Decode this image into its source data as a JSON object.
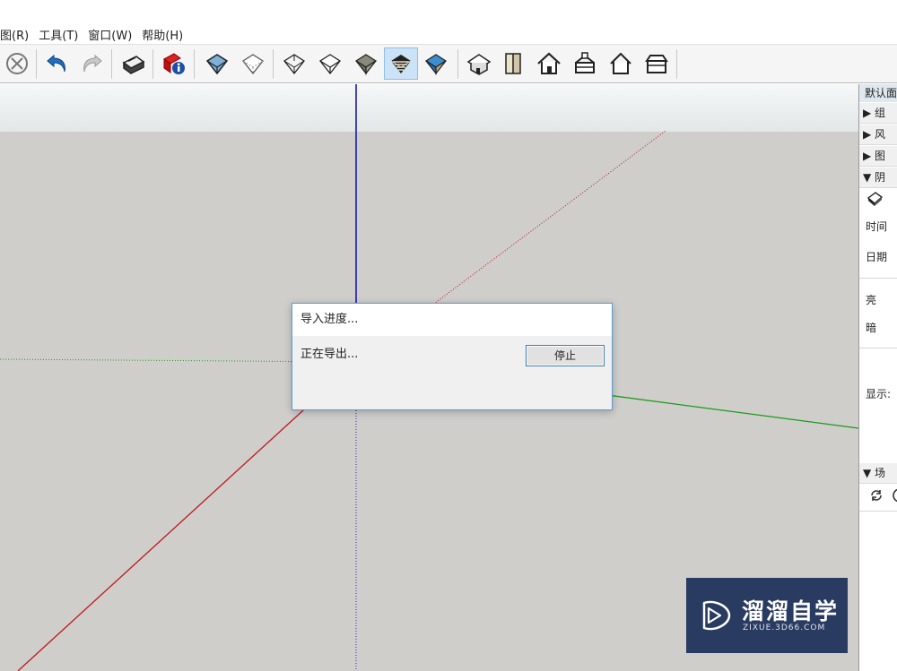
{
  "menu": [
    "图(R)",
    "工具(T)",
    "窗口(W)",
    "帮助(H)"
  ],
  "toolbar": {
    "tools": [
      {
        "name": "cancel-icon",
        "active": false
      },
      {
        "name": "undo-icon",
        "active": false
      },
      {
        "name": "redo-icon",
        "active": false
      },
      {
        "name": "print-icon",
        "active": false
      },
      {
        "name": "model-info-icon",
        "active": false
      },
      {
        "name": "xray-style-icon",
        "active": false
      },
      {
        "name": "back-edges-style-icon",
        "active": false
      },
      {
        "name": "wireframe-style-icon",
        "active": false
      },
      {
        "name": "hidden-line-style-icon",
        "active": false
      },
      {
        "name": "shaded-style-icon",
        "active": false
      },
      {
        "name": "shaded-textures-style-icon",
        "active": true
      },
      {
        "name": "monochrome-style-icon",
        "active": false
      },
      {
        "name": "iso-view-icon",
        "active": false
      },
      {
        "name": "top-view-icon",
        "active": false
      },
      {
        "name": "front-view-icon",
        "active": false
      },
      {
        "name": "right-view-icon",
        "active": false
      },
      {
        "name": "back-view-icon",
        "active": false
      },
      {
        "name": "left-view-icon",
        "active": false
      }
    ]
  },
  "colors": {
    "accent_blue": "#5b9bd5",
    "axis_red": "#c0161b",
    "axis_green": "#1a9b1a",
    "axis_blue": "#1a1ab0",
    "ground": "#cfcecb",
    "watermark_bg": "#2a3b62"
  },
  "tray": {
    "title": "默认面",
    "sections": [
      "▶ 组",
      "▶ 风",
      "▶ 图",
      "▼ 阴"
    ],
    "shadow_icon": "shadow-icon",
    "fields": {
      "time": "时间",
      "date": "日期",
      "light": "亮",
      "dark": "暗",
      "display": "显示:"
    },
    "scenes_section": "▼ 场",
    "scenes_icons": [
      "refresh-icon",
      "add-scene-icon"
    ]
  },
  "dialog": {
    "title": "导入进度...",
    "message": "正在导出...",
    "stop_label": "停止"
  },
  "watermark": {
    "text": "溜溜自学",
    "url": "ZIXUE.3D66.COM",
    "icon": "play-logo-icon"
  }
}
